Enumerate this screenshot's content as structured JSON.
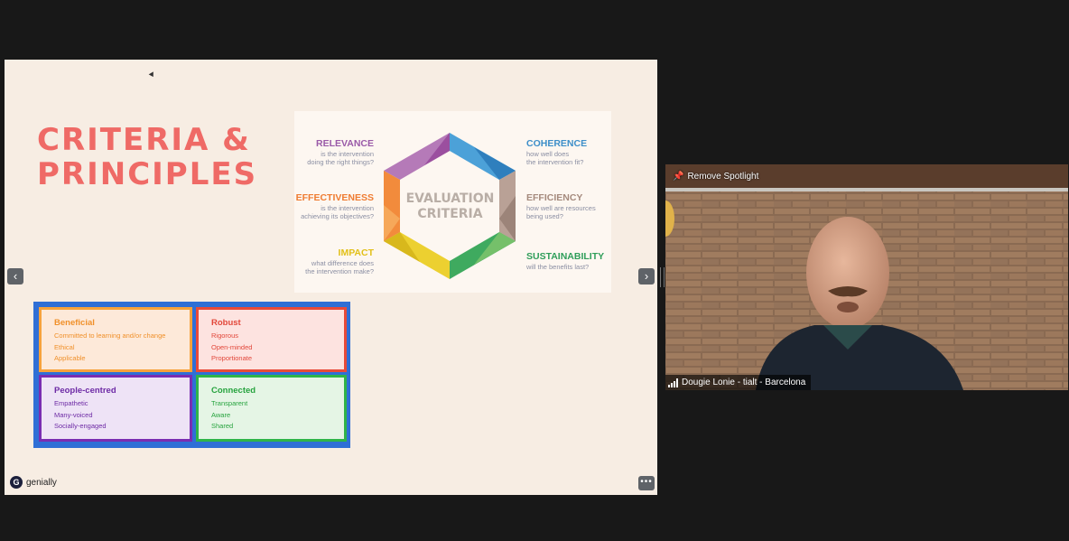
{
  "slide": {
    "title_line1": "CRITERIA &",
    "title_line2": "PRINCIPLES",
    "nav_prev": "‹",
    "nav_next": "›",
    "more": "•••",
    "brand": "genially",
    "brand_icon": "genially-logo-icon"
  },
  "evaluation": {
    "center_line1": "EVALUATION",
    "center_line2": "CRITERIA",
    "criteria": [
      {
        "name": "RELEVANCE",
        "line1": "is the intervention",
        "line2": "doing the right things?",
        "color": "#9a5aa8"
      },
      {
        "name": "EFFECTIVENESS",
        "line1": "is the intervention",
        "line2": "achieving its objectives?",
        "color": "#ef7c32"
      },
      {
        "name": "IMPACT",
        "line1": "what difference does",
        "line2": "the intervention make?",
        "color": "#e2c019"
      },
      {
        "name": "COHERENCE",
        "line1": "how well does",
        "line2": "the intervention fit?",
        "color": "#3d8fc9"
      },
      {
        "name": "EFFICIENCY",
        "line1": "how well are resources",
        "line2": "being used?",
        "color": "#a58a7d"
      },
      {
        "name": "SUSTAINABILITY",
        "line1": "will the benefits last?",
        "line2": "",
        "color": "#2f9e5a"
      }
    ]
  },
  "principles": [
    {
      "heading": "Beneficial",
      "items": [
        "Committed to learning and/or change",
        "Ethical",
        "Applicable"
      ]
    },
    {
      "heading": "Robust",
      "items": [
        "Rigorous",
        "Open-minded",
        "Proportionate"
      ]
    },
    {
      "heading": "People-centred",
      "items": [
        "Empathetic",
        "Many-voiced",
        "Socially-engaged"
      ]
    },
    {
      "heading": "Connected",
      "items": [
        "Transparent",
        "Aware",
        "Shared"
      ]
    }
  ],
  "video": {
    "spotlight_label": "Remove Spotlight",
    "spotlight_icon": "pin-icon",
    "participant_name": "Dougie Lonie - tialt - Barcelona",
    "signal_icon": "signal-bars-icon"
  }
}
